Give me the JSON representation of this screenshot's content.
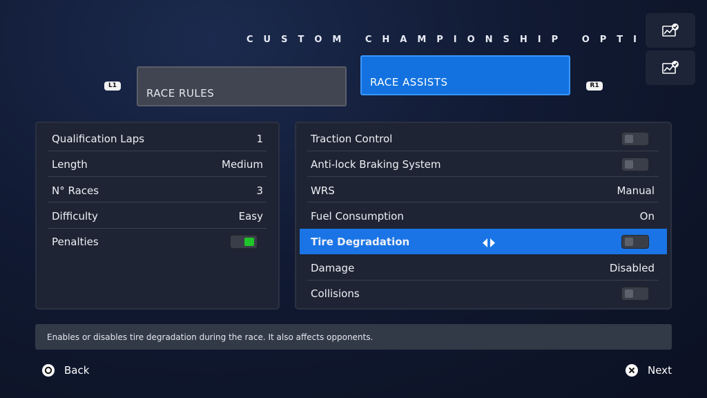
{
  "header": {
    "title": "CUSTOM CHAMPIONSHIP OPTIONS"
  },
  "icons": {
    "top": "chart-check-icon",
    "bottom": "chart-check-icon"
  },
  "tabs": {
    "left_button": "L1",
    "right_button": "R1",
    "items": [
      {
        "label": "RACE RULES",
        "active": false
      },
      {
        "label": "RACE ASSISTS",
        "active": true
      }
    ]
  },
  "rules": [
    {
      "label": "Qualification Laps",
      "value": "1"
    },
    {
      "label": "Length",
      "value": "Medium"
    },
    {
      "label": "N° Races",
      "value": "3"
    },
    {
      "label": "Difficulty",
      "value": "Easy"
    },
    {
      "label": "Penalties",
      "toggle": "on"
    }
  ],
  "assists": [
    {
      "label": "Traction Control",
      "toggle": "off"
    },
    {
      "label": "Anti-lock Braking System",
      "toggle": "off"
    },
    {
      "label": "WRS",
      "value": "Manual"
    },
    {
      "label": "Fuel Consumption",
      "value": "On"
    },
    {
      "label": "Tire Degradation",
      "toggle": "off",
      "selected": true
    },
    {
      "label": "Damage",
      "value": "Disabled"
    },
    {
      "label": "Collisions",
      "toggle": "off"
    }
  ],
  "description": "Enables or disables tire degradation during the race. It also affects opponents.",
  "footer": {
    "back_label": "Back",
    "next_label": "Next"
  },
  "colors": {
    "accent": "#1a74e6",
    "toggle_on": "#1fc62a"
  }
}
